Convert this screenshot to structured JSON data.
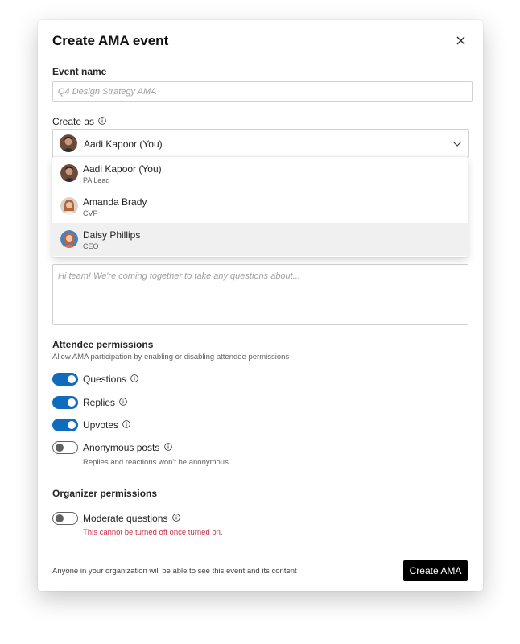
{
  "dialog": {
    "title": "Create AMA event"
  },
  "event_name": {
    "label": "Event name",
    "placeholder": "Q4 Design Strategy AMA",
    "value": ""
  },
  "create_as": {
    "label": "Create as",
    "selected": "Aadi Kapoor (You)",
    "options": [
      {
        "name": "Aadi Kapoor (You)",
        "role": "PA Lead"
      },
      {
        "name": "Amanda Brady",
        "role": "CVP"
      },
      {
        "name": "Daisy Phillips",
        "role": "CEO"
      }
    ],
    "highlighted_index": 2
  },
  "description": {
    "placeholder": "Hi team! We're coming together to take any questions about..."
  },
  "attendee_permissions": {
    "title": "Attendee permissions",
    "description": "Allow AMA participation by enabling or disabling attendee permissions",
    "toggles": [
      {
        "label": "Questions",
        "on": true
      },
      {
        "label": "Replies",
        "on": true
      },
      {
        "label": "Upvotes",
        "on": true
      },
      {
        "label": "Anonymous posts",
        "on": false,
        "note": "Replies and reactions won't be anonymous"
      }
    ]
  },
  "organizer_permissions": {
    "title": "Organizer permissions",
    "toggles": [
      {
        "label": "Moderate questions",
        "on": false,
        "warning": "This cannot be turned off once turned on."
      }
    ]
  },
  "footer": {
    "note": "Anyone in your organization will be able to see this event and its content",
    "create_label": "Create AMA"
  },
  "colors": {
    "toggle_on": "#0f6cbd",
    "warning": "#c4314b",
    "primary_button": "#000000"
  }
}
